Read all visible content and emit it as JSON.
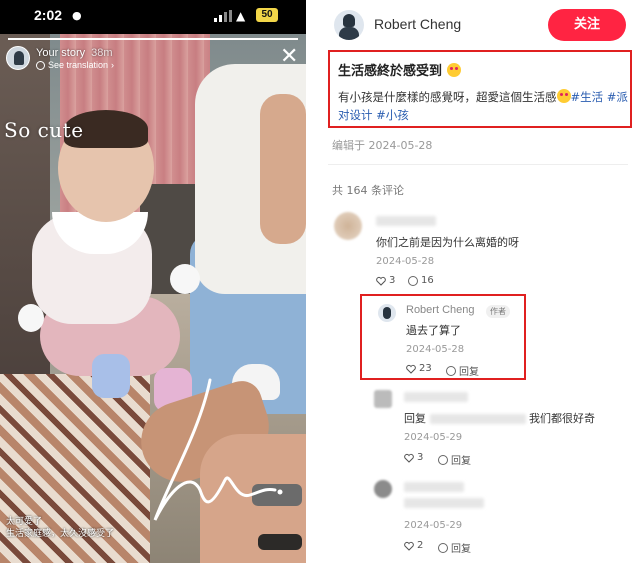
{
  "story": {
    "status_time": "2:02",
    "battery": "50",
    "owner": "Your story",
    "age": "38m",
    "translate": "See translation",
    "close_icon": "close-icon",
    "sticker": "So cute",
    "caption_line1": "太可愛了",
    "caption_line2": "生活家庭感，太久沒感受了",
    "progress": 1.0
  },
  "post": {
    "author": "Robert Cheng",
    "follow_label": "关注",
    "title": "生活感終於感受到",
    "body": "有小孩是什麼樣的感覺呀，超愛這個生活感",
    "tags": [
      "#生活",
      "#派对设计",
      "#小孩"
    ],
    "edited": "编辑于 2024-05-28",
    "comment_count": "共 164 条评论"
  },
  "comments": [
    {
      "text": "你们之前是因为什么离婚的呀",
      "date": "2024-05-28",
      "likes": "3",
      "replies": "16"
    }
  ],
  "replies": [
    {
      "name": "Robert Cheng",
      "badge": "作者",
      "text": "過去了算了",
      "date": "2024-05-28",
      "likes": "23",
      "action": "回复"
    },
    {
      "text_prefix": "回复",
      "text_suffix": "我们都很好奇",
      "date": "2024-05-29",
      "likes": "3",
      "action": "回复"
    },
    {
      "date": "2024-05-29",
      "likes": "2",
      "action": "回复"
    }
  ],
  "colors": {
    "accent": "#ff2442",
    "highlight_border": "#e02020",
    "tag": "#2a5db0"
  }
}
